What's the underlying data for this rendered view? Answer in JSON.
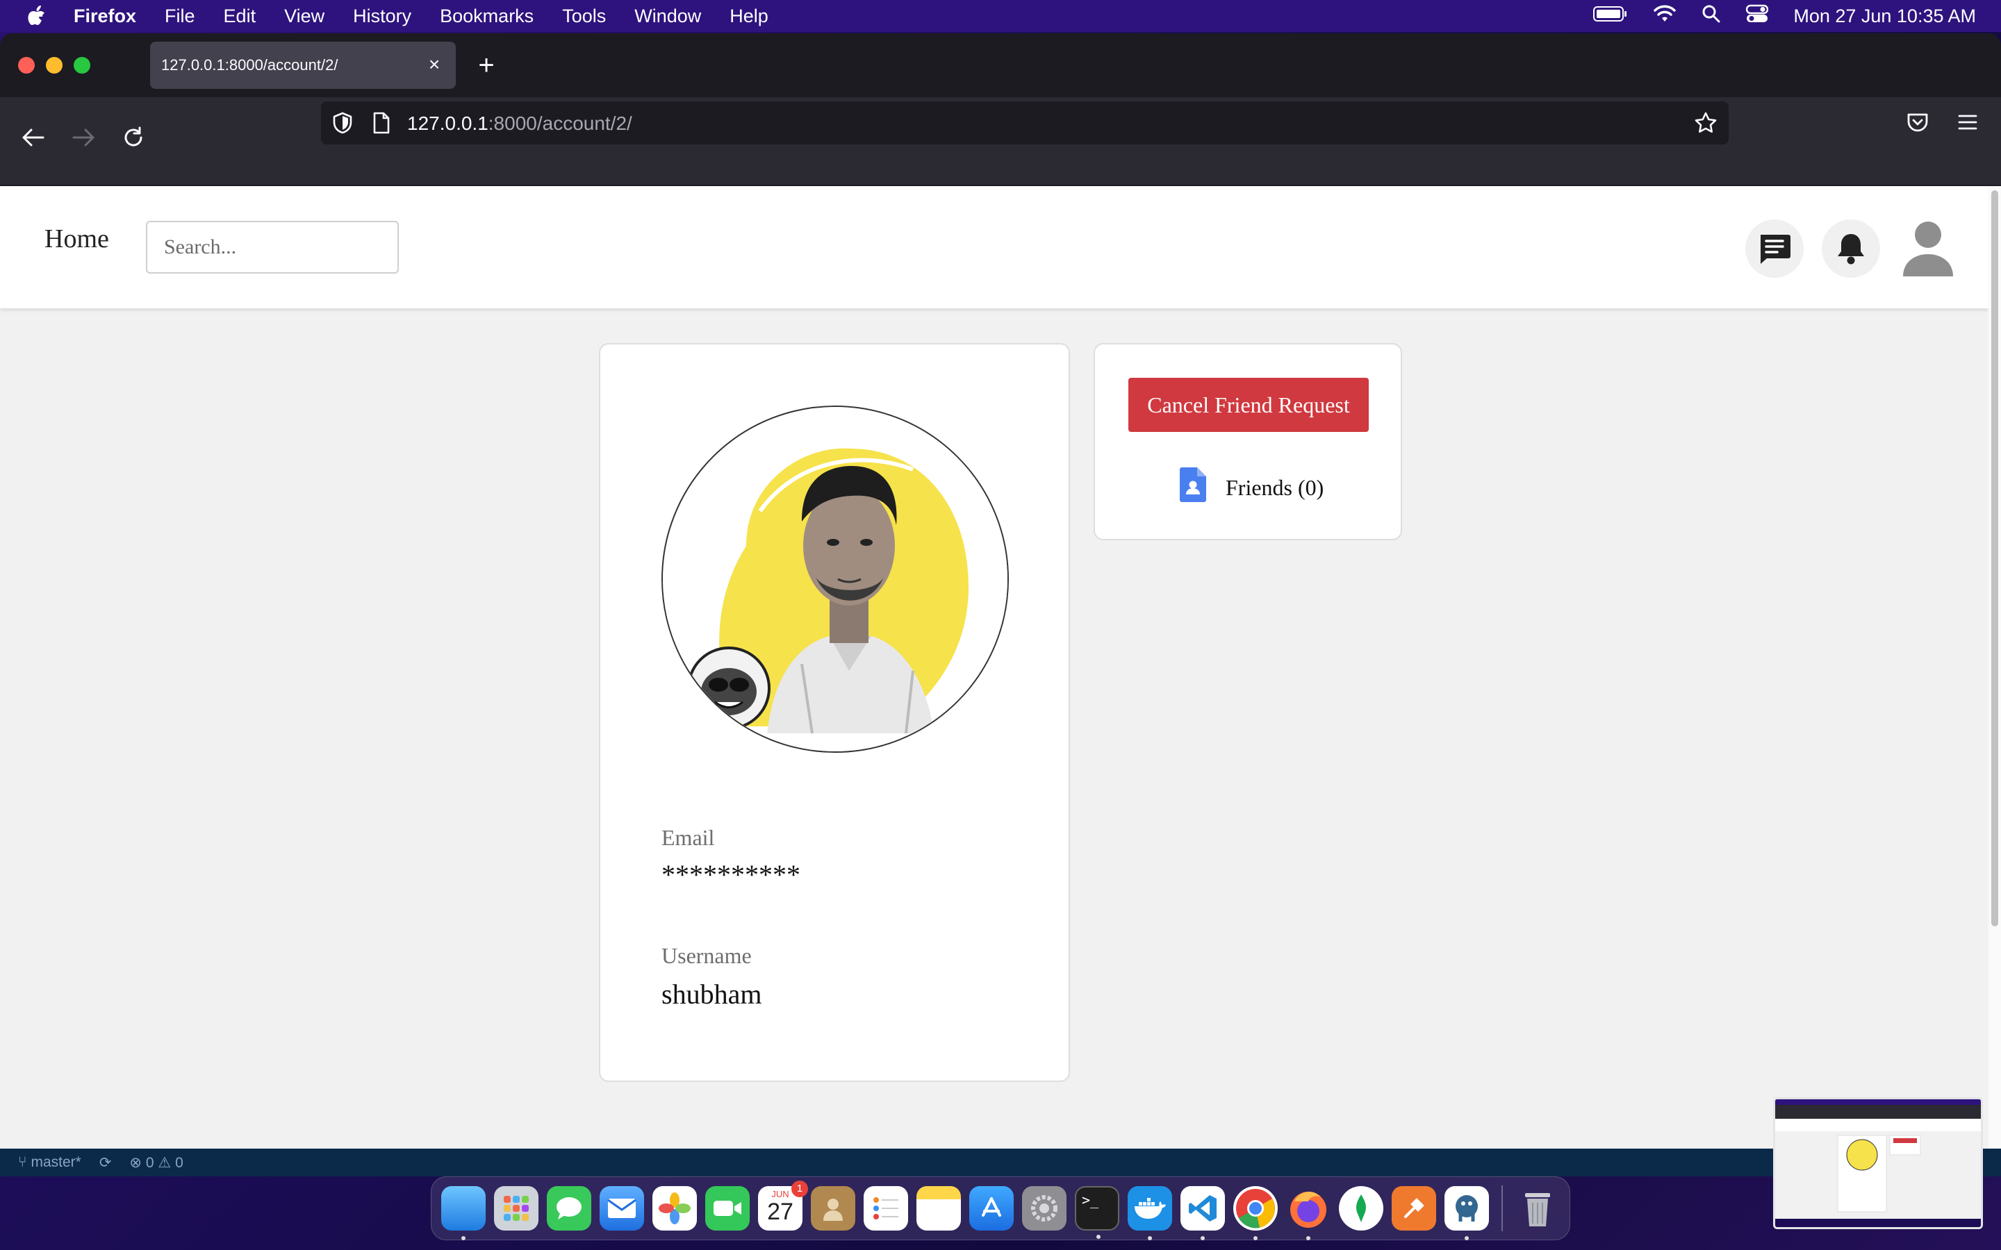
{
  "menubar": {
    "app_name": "Firefox",
    "items": [
      "File",
      "Edit",
      "View",
      "History",
      "Bookmarks",
      "Tools",
      "Window",
      "Help"
    ],
    "clock": "Mon 27 Jun  10:35 AM"
  },
  "browser": {
    "tab_title": "127.0.0.1:8000/account/2/",
    "url_host": "127.0.0.1",
    "url_path": ":8000/account/2/"
  },
  "site": {
    "home_label": "Home",
    "search_placeholder": "Search..."
  },
  "profile": {
    "email_label": "Email",
    "email_value": "**********",
    "username_label": "Username",
    "username_value": "shubham"
  },
  "actions": {
    "cancel_request_label": "Cancel Friend Request",
    "friends_label": "Friends (0)"
  },
  "statusbar": {
    "branch": "master*",
    "problems": "0",
    "warnings": "0"
  },
  "dock": {
    "calendar_month": "JUN",
    "calendar_day": "27",
    "calendar_badge": "1"
  },
  "colors": {
    "cancel_button": "#d0393f",
    "photo_bg": "#f6e24a",
    "friends_icon": "#4a7ff0"
  }
}
